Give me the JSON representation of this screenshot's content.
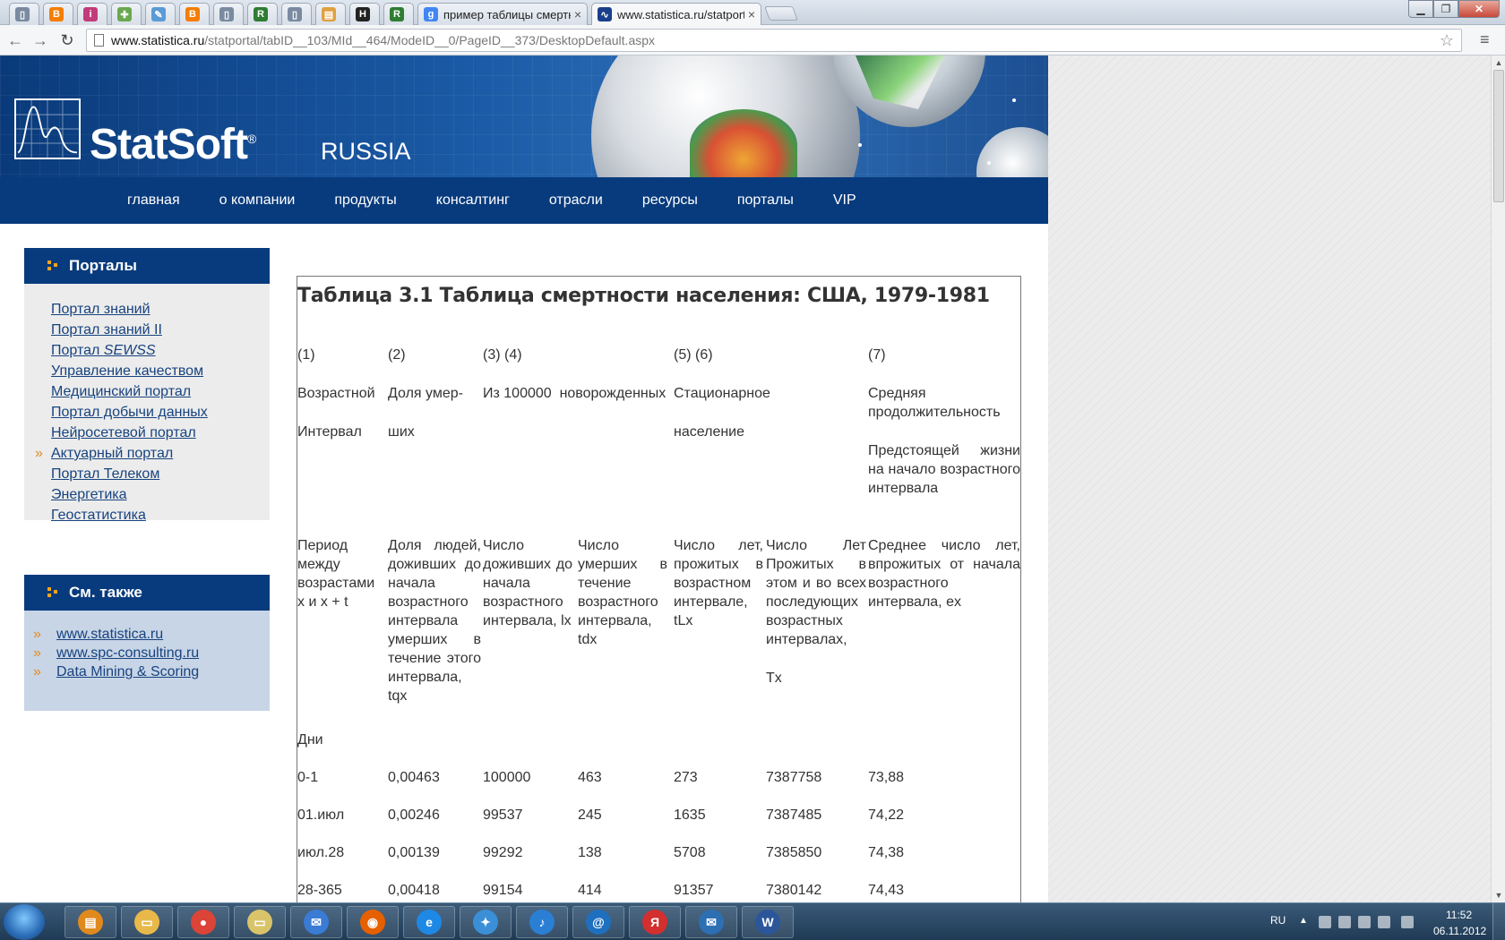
{
  "browser": {
    "tabs": [
      {
        "title": "",
        "icon": "page-icon",
        "color": "#7a8aa0"
      },
      {
        "title": "",
        "icon": "blogger-icon",
        "color": "#f57d00"
      },
      {
        "title": "",
        "icon": "info-icon",
        "color": "#c23b7a"
      },
      {
        "title": "",
        "icon": "puzzle-icon",
        "color": "#6aa84f"
      },
      {
        "title": "",
        "icon": "pencil-icon",
        "color": "#5b9bd5"
      },
      {
        "title": "",
        "icon": "blogger-icon",
        "color": "#f57d00"
      },
      {
        "title": "",
        "icon": "page-icon",
        "color": "#7a8aa0"
      },
      {
        "title": "",
        "icon": "r-icon",
        "color": "#2e7d32"
      },
      {
        "title": "",
        "icon": "page-icon",
        "color": "#7a8aa0"
      },
      {
        "title": "",
        "icon": "book-icon",
        "color": "#e0a040"
      },
      {
        "title": "",
        "icon": "h-icon",
        "color": "#222222"
      },
      {
        "title": "",
        "icon": "r-icon",
        "color": "#2e7d32"
      },
      {
        "title": "пример таблицы смертн",
        "icon": "google-icon",
        "color": "#4285f4"
      },
      {
        "title": "www.statistica.ru/statporta",
        "icon": "statsoft-icon",
        "color": "#1a3f8a"
      }
    ],
    "url_host": "www.statistica.ru",
    "url_path": "/statportal/tabID__103/MId__464/ModeID__0/PageID__373/DesktopDefault.aspx"
  },
  "header": {
    "logo_text": "StatSoft",
    "registered": "®",
    "logo_sub": "RUSSIA",
    "nav": [
      "главная",
      "о компании",
      "продукты",
      "консалтинг",
      "отрасли",
      "ресурсы",
      "порталы",
      "VIP"
    ]
  },
  "sidebar": {
    "portals_title": "Порталы",
    "portals": [
      {
        "label": "Портал знаний",
        "active": false
      },
      {
        "label": "Портал знаний II",
        "active": false
      },
      {
        "label": "Портал ",
        "italic_suffix": "SEWSS",
        "active": false
      },
      {
        "label": "Управление качеством",
        "active": false
      },
      {
        "label": "Медицинский портал",
        "active": false
      },
      {
        "label": "Портал добычи данных",
        "active": false
      },
      {
        "label": "Нейросетевой портал",
        "active": false
      },
      {
        "label": "Актуарный портал",
        "active": true
      },
      {
        "label": "Портал Телеком",
        "active": false
      },
      {
        "label": "Энергетика",
        "active": false
      },
      {
        "label": "Геостатистика",
        "active": false
      }
    ],
    "see_also_title": "См. также",
    "see_also": [
      "www.statistica.ru",
      "www.spc-consulting.ru",
      "Data Mining & Scoring"
    ],
    "arrow": "»"
  },
  "article": {
    "title": "Таблица 3.1 Таблица смертности населения: США, 1979-1981",
    "col_numbers": [
      "(1)",
      "(2)",
      "(3) (4)",
      "(5) (6)",
      "(7)"
    ],
    "headers1": [
      "Возрастной",
      "Доля умер-",
      "Из 100000  новорожденных",
      "Стационарное",
      "Средняя продолжительность"
    ],
    "headers2": [
      "Интервал",
      "ших",
      "население",
      "Предстоящей жизни на начало возрастного интервала"
    ],
    "descriptions": [
      "Период между возрастами x и x + t",
      "Доля людей, доживших до начала возрастного интервала умерших в течение этого интервала, tqx",
      "Число доживших до начала возрастного интервала, lx",
      "Число умерших в течение возрастного интервала, tdx",
      "Число лет, прожитых в возрастном интервале, tLx",
      "Число Лет Прожитых в этом и во всех последующих возрастных интервалах,",
      "Среднее число лет, впрожитых от начала возрастного интервала, ex"
    ],
    "tx_label": "Tx",
    "section_label": "Дни",
    "rows": [
      [
        "0-1",
        "0,00463",
        "100000",
        "463",
        "273",
        "7387758",
        "73,88"
      ],
      [
        "01.июл",
        "0,00246",
        "99537",
        "245",
        "1635",
        "7387485",
        "74,22"
      ],
      [
        "июл.28",
        "0,00139",
        "99292",
        "138",
        "5708",
        "7385850",
        "74,38"
      ],
      [
        "28-365",
        "0,00418",
        "99154",
        "414",
        "91357",
        "7380142",
        "74,43"
      ]
    ]
  },
  "taskbar": {
    "apps": [
      {
        "name": "notes-app-icon",
        "color": "#e08a1e",
        "glyph": "▤"
      },
      {
        "name": "explorer-folder-icon",
        "color": "#e8b94a",
        "glyph": "▭"
      },
      {
        "name": "chrome-icon",
        "color": "#db4437",
        "glyph": "●"
      },
      {
        "name": "folder-icon",
        "color": "#d9c46a",
        "glyph": "▭"
      },
      {
        "name": "mail-client-icon",
        "color": "#3a7bd5",
        "glyph": "✉"
      },
      {
        "name": "firefox-icon",
        "color": "#e66000",
        "glyph": "◉"
      },
      {
        "name": "internet-explorer-icon",
        "color": "#1e88e5",
        "glyph": "e"
      },
      {
        "name": "safari-icon",
        "color": "#3b8fd6",
        "glyph": "✦"
      },
      {
        "name": "itunes-icon",
        "color": "#2a7fd4",
        "glyph": "♪"
      },
      {
        "name": "at-mail-icon",
        "color": "#1f6fbf",
        "glyph": "@"
      },
      {
        "name": "yandex-icon",
        "color": "#d32f2f",
        "glyph": "Я"
      },
      {
        "name": "email-icon",
        "color": "#2d6fb3",
        "glyph": "✉"
      },
      {
        "name": "word-icon",
        "color": "#2b579a",
        "glyph": "W"
      }
    ],
    "lang": "RU",
    "time": "11:52",
    "date": "06.11.2012"
  }
}
